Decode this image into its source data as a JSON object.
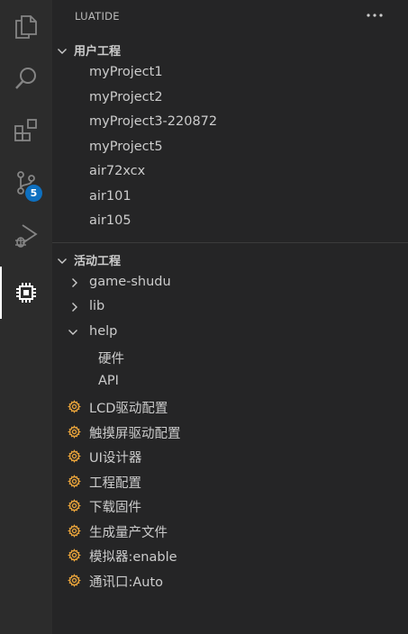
{
  "activity_bar": {
    "items": [
      {
        "name": "explorer-icon"
      },
      {
        "name": "search-icon"
      },
      {
        "name": "extensions-icon"
      },
      {
        "name": "source-control-icon",
        "badge": "5"
      },
      {
        "name": "run-debug-icon"
      },
      {
        "name": "luatide-chip-icon",
        "active": true
      }
    ],
    "badge_color": "#0e70c0"
  },
  "sidebar": {
    "title": "LUATIDE",
    "more_icon": "ellipsis-icon",
    "user_projects": {
      "header": "用户工程",
      "items": [
        "myProject1",
        "myProject2",
        "myProject3-220872",
        "myProject5",
        "air72xcx",
        "air101",
        "air105"
      ]
    },
    "active_project": {
      "header": "活动工程",
      "folders": [
        {
          "label": "game-shudu",
          "expanded": false
        },
        {
          "label": "lib",
          "expanded": false
        },
        {
          "label": "help",
          "expanded": true,
          "children": [
            "硬件",
            "API"
          ]
        }
      ],
      "settings": [
        "LCD驱动配置",
        "触摸屏驱动配置",
        "UI设计器",
        "工程配置",
        "下载固件",
        "生成量产文件",
        "模拟器:enable",
        "通讯口:Auto"
      ],
      "gear_color": "#e8a33b"
    }
  }
}
